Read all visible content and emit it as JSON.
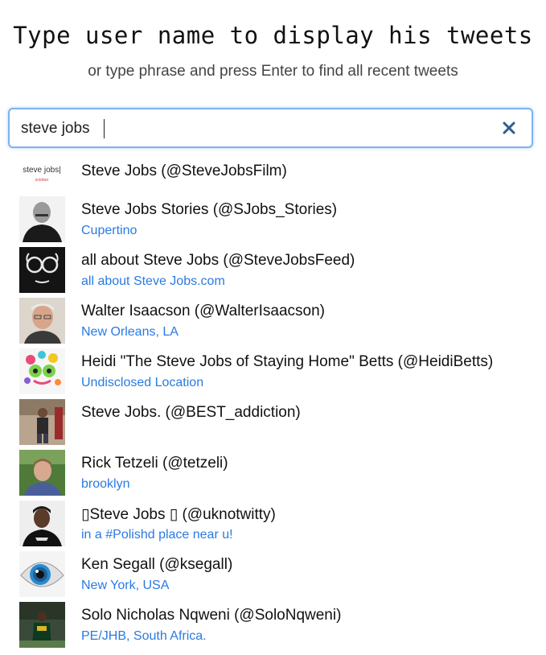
{
  "header": {
    "title": "Type user name to display his tweets",
    "subtitle": "or type phrase and press Enter to find all recent tweets"
  },
  "search": {
    "value": "steve jobs",
    "clear_icon": "close-icon"
  },
  "colors": {
    "accent": "#2a7ae2",
    "focus_border": "#7fb2ee"
  },
  "results": [
    {
      "display": "Steve Jobs (@SteveJobsFilm)",
      "location": "",
      "avatar_icon": "steve-jobs-film-logo-avatar",
      "avatar_text": "steve jobs|",
      "avatar_subtext": "october"
    },
    {
      "display": "Steve Jobs Stories (@SJobs_Stories)",
      "location": "Cupertino",
      "avatar_icon": "portrait-avatar"
    },
    {
      "display": "all about Steve Jobs (@SteveJobsFeed)",
      "location": "all about Steve Jobs.com",
      "avatar_icon": "glasses-face-avatar"
    },
    {
      "display": "Walter Isaacson (@WalterIsaacson)",
      "location": "New Orleans, LA",
      "avatar_icon": "portrait-avatar"
    },
    {
      "display": "Heidi \"The Steve Jobs of Staying Home\" Betts (@HeidiBetts)",
      "location": "Undisclosed Location",
      "avatar_icon": "colorful-illustration-avatar"
    },
    {
      "display": "Steve Jobs. (@BEST_addiction)",
      "location": "",
      "avatar_icon": "photo-avatar"
    },
    {
      "display": "Rick Tetzeli (@tetzeli)",
      "location": "brooklyn",
      "avatar_icon": "portrait-avatar"
    },
    {
      "display": "▯Steve Jobs ▯ (@uknotwitty)",
      "location": "in a #Polishd place near u!",
      "avatar_icon": "portrait-avatar"
    },
    {
      "display": "Ken Segall (@ksegall)",
      "location": "New York, USA",
      "avatar_icon": "eye-illustration-avatar"
    },
    {
      "display": "Solo Nicholas Nqweni (@SoloNqweni)",
      "location": "PE/JHB, South Africa.",
      "avatar_icon": "photo-avatar"
    }
  ]
}
